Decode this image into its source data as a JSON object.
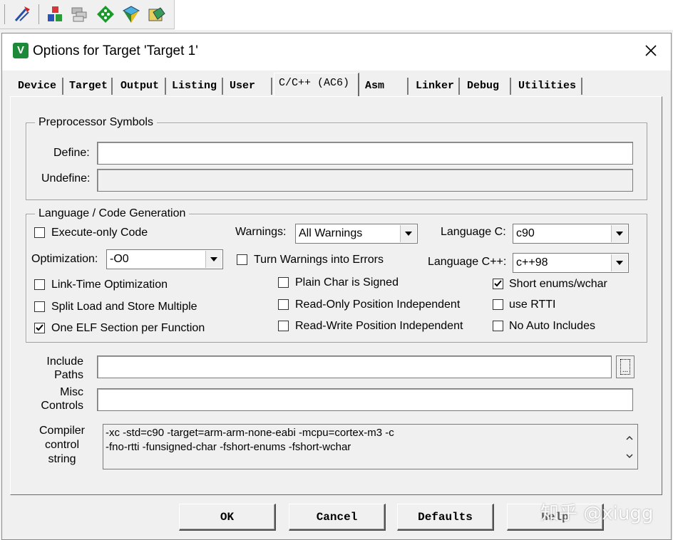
{
  "toolbar": {
    "icons": [
      "build-wand-icon",
      "target-options-icon",
      "manage-components-icon",
      "select-packs-icon",
      "pack-installer-icon",
      "event-recorder-icon"
    ]
  },
  "dialog": {
    "title": "Options for Target 'Target 1'",
    "close_symbol": "✕"
  },
  "tabs": [
    {
      "label": "Device",
      "active": false
    },
    {
      "label": "Target",
      "active": false
    },
    {
      "label": "Output",
      "active": false
    },
    {
      "label": "Listing",
      "active": false
    },
    {
      "label": "User",
      "active": false
    },
    {
      "label": "C/C++ (AC6)",
      "active": true
    },
    {
      "label": "Asm",
      "active": false
    },
    {
      "label": "Linker",
      "active": false
    },
    {
      "label": "Debug",
      "active": false
    },
    {
      "label": "Utilities",
      "active": false
    }
  ],
  "preprocessor": {
    "group_label": "Preprocessor Symbols",
    "define_label": "Define:",
    "define_value": "",
    "undefine_label": "Undefine:",
    "undefine_value": ""
  },
  "language": {
    "group_label": "Language / Code Generation",
    "execute_only": {
      "label": "Execute-only Code",
      "checked": false
    },
    "warnings_label": "Warnings:",
    "warnings_value": "All Warnings",
    "language_c_label": "Language C:",
    "language_c_value": "c90",
    "optimization_label": "Optimization:",
    "optimization_value": "-O0",
    "turn_warnings_errors": {
      "label": "Turn Warnings into Errors",
      "checked": false
    },
    "language_cpp_label": "Language C++:",
    "language_cpp_value": "c++98",
    "link_time_opt": {
      "label": "Link-Time Optimization",
      "checked": false
    },
    "plain_char_signed": {
      "label": "Plain Char is Signed",
      "checked": false
    },
    "short_enums": {
      "label": "Short enums/wchar",
      "checked": true
    },
    "split_load_store": {
      "label": "Split Load and Store Multiple",
      "checked": false
    },
    "ro_pos_indep": {
      "label": "Read-Only Position Independent",
      "checked": false
    },
    "use_rtti": {
      "label": "use RTTI",
      "checked": false
    },
    "one_elf_section": {
      "label": "One ELF Section per Function",
      "checked": true
    },
    "rw_pos_indep": {
      "label": "Read-Write Position Independent",
      "checked": false
    },
    "no_auto_includes": {
      "label": "No Auto Includes",
      "checked": false
    }
  },
  "paths": {
    "include_label_1": "Include",
    "include_label_2": "Paths",
    "include_value": "",
    "browse_label": "...",
    "misc_label_1": "Misc",
    "misc_label_2": "Controls",
    "misc_value": ""
  },
  "compiler": {
    "label_1": "Compiler",
    "label_2": "control",
    "label_3": "string",
    "line_1": "-xc -std=c90 -target=arm-arm-none-eabi -mcpu=cortex-m3 -c",
    "line_2": "-fno-rtti -funsigned-char -fshort-enums -fshort-wchar"
  },
  "buttons": {
    "ok": "OK",
    "cancel": "Cancel",
    "defaults": "Defaults",
    "help": "Help"
  },
  "watermark": "知乎 @xiugg"
}
